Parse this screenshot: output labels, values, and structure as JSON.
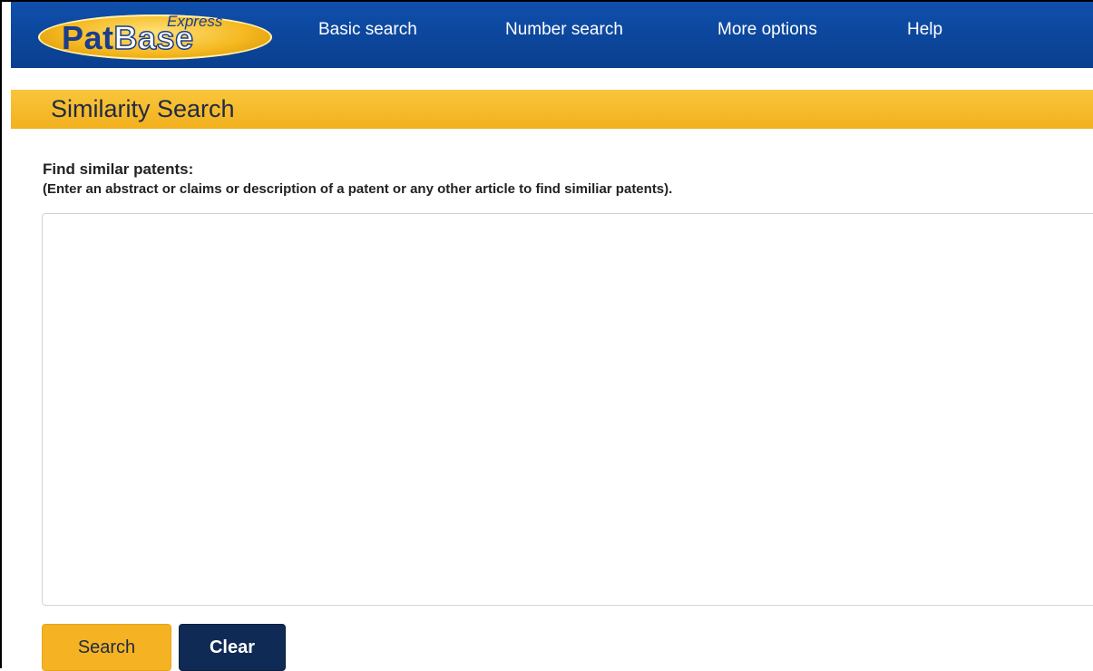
{
  "logo": {
    "brand_pat": "Pat",
    "brand_base": "Base",
    "tagline": "Express"
  },
  "nav": {
    "items": [
      {
        "label": "Basic search"
      },
      {
        "label": "Number search"
      },
      {
        "label": "More options"
      },
      {
        "label": "Help"
      }
    ]
  },
  "section": {
    "title": "Similarity Search"
  },
  "form": {
    "label": "Find similar patents:",
    "hint": "(Enter an abstract or claims or description of a patent or any other article to find similiar patents).",
    "textarea_value": "",
    "search_label": "Search",
    "clear_label": "Clear"
  },
  "colors": {
    "nav_bar": "#0d4aa2",
    "section_header": "#f7bb2c",
    "search_button": "#f5b323",
    "clear_button": "#0f2a54"
  }
}
